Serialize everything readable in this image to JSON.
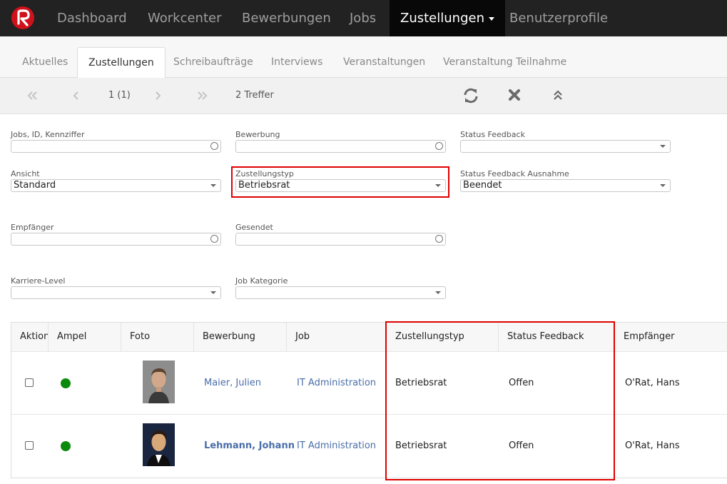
{
  "nav": {
    "items": [
      "Dashboard",
      "Workcenter",
      "Bewerbungen",
      "Jobs",
      "Zustellungen",
      "Benutzerprofile"
    ],
    "active_index": 4
  },
  "tabs": [
    "Aktuelles",
    "Zustellungen",
    "Schreibaufträge",
    "Interviews",
    "Veranstaltungen",
    "Veranstaltung Teilnahme"
  ],
  "active_tab": 1,
  "toolbar": {
    "page": "1 (1)",
    "hits": "2 Treffer"
  },
  "filters": {
    "jobs": {
      "label": "Jobs, ID, Kennziffer",
      "value": ""
    },
    "bewerbung": {
      "label": "Bewerbung",
      "value": ""
    },
    "status_feedback": {
      "label": "Status Feedback",
      "value": ""
    },
    "ansicht": {
      "label": "Ansicht",
      "value": "Standard"
    },
    "zustellungstyp": {
      "label": "Zustellungstyp",
      "value": "Betriebsrat"
    },
    "status_ausnahme": {
      "label": "Status Feedback Ausnahme",
      "value": "Beendet"
    },
    "empfaenger": {
      "label": "Empfänger",
      "value": ""
    },
    "gesendet": {
      "label": "Gesendet",
      "value": ""
    },
    "karriere": {
      "label": "Karriere-Level",
      "value": ""
    },
    "kategorie": {
      "label": "Job Kategorie",
      "value": ""
    }
  },
  "table": {
    "headers": [
      "Aktion",
      "Ampel",
      "Foto",
      "Bewerbung",
      "Job",
      "Zustellungstyp",
      "Status Feedback",
      "Empfänger"
    ],
    "rows": [
      {
        "bewerbung": "Maier, Julien",
        "job": "IT Administration",
        "typ": "Betriebsrat",
        "status": "Offen",
        "empfaenger": "O'Rat, Hans"
      },
      {
        "bewerbung": "Lehmann, Johann",
        "job": "IT Administration",
        "typ": "Betriebsrat",
        "status": "Offen",
        "empfaenger": "O'Rat, Hans"
      }
    ]
  },
  "colors": {
    "ampel": "#0a8a0a",
    "highlight": "#e00000",
    "link": "#4a6ea9"
  }
}
